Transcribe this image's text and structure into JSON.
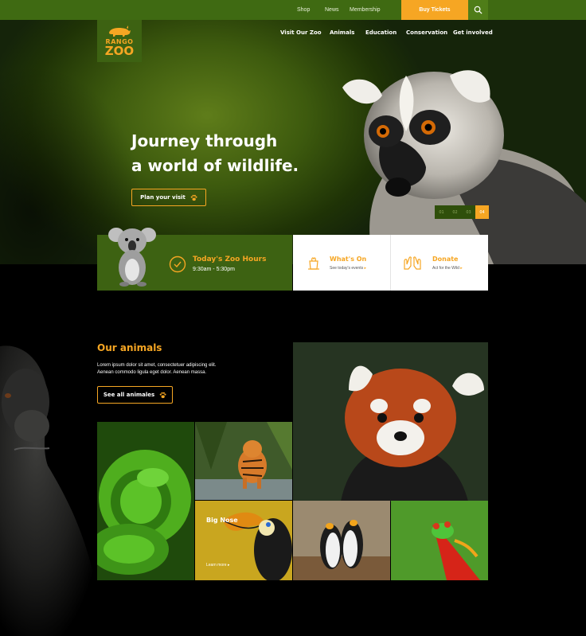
{
  "topbar": {
    "links": [
      "Shop",
      "News",
      "Membership"
    ],
    "buy_label": "Buy Tickets"
  },
  "logo": {
    "line1": "RANGO",
    "line2": "ZOO"
  },
  "nav": [
    "Visit Our Zoo",
    "Animals",
    "Education",
    "Conservation",
    "Get involved"
  ],
  "hero": {
    "headline_line1": "Journey through",
    "headline_line2": "a world of wildlife.",
    "cta_label": "Plan your visit",
    "slides": [
      "01",
      "02",
      "03",
      "04"
    ],
    "active_slide": "04"
  },
  "hours": {
    "title": "Today's Zoo Hours",
    "time": "9:30am - 5:30pm"
  },
  "whats_on": {
    "title": "What's On",
    "subtitle": "See today's events"
  },
  "donate": {
    "title": "Donate",
    "subtitle": "Act for the Wild"
  },
  "animals": {
    "title": "Our animals",
    "description_line1": "Lorem ipsum dolor sit amet, consectetuer adipiscing elit.",
    "description_line2": "Aenean commodo ligula eget dolor. Aenean massa.",
    "cta_label": "See all animales",
    "featured_title": "Big Nose",
    "featured_link": "Learn more"
  },
  "colors": {
    "brand_green": "#3d6212",
    "accent_orange": "#f6a623"
  }
}
